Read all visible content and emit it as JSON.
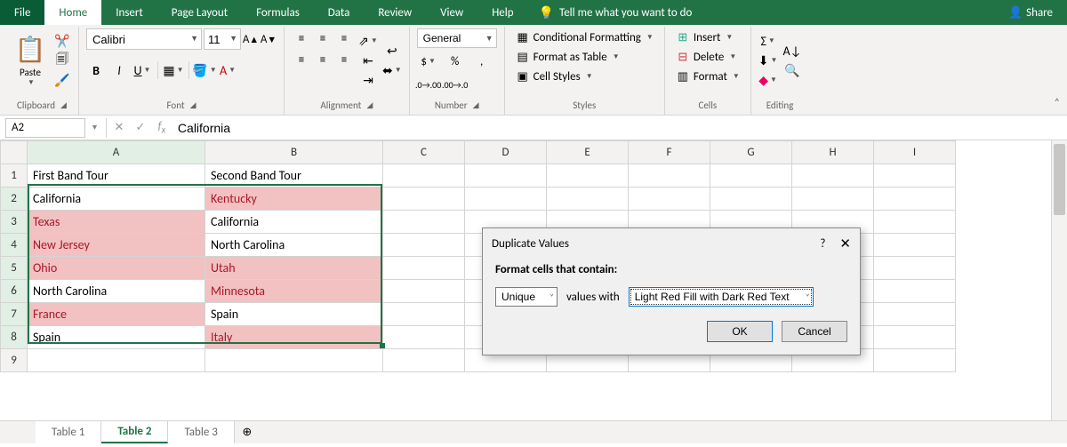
{
  "tabs": {
    "file": "File",
    "home": "Home",
    "insert": "Insert",
    "pagelayout": "Page Layout",
    "formulas": "Formulas",
    "data": "Data",
    "review": "Review",
    "view": "View",
    "help": "Help",
    "tellme": "Tell me what you want to do",
    "share": "Share"
  },
  "ribbon": {
    "clipboard": {
      "label": "Clipboard",
      "paste": "Paste"
    },
    "font": {
      "label": "Font",
      "name": "Calibri",
      "size": "11"
    },
    "alignment": {
      "label": "Alignment"
    },
    "number": {
      "label": "Number",
      "format": "General"
    },
    "styles": {
      "label": "Styles",
      "cond": "Conditional Formatting",
      "table": "Format as Table",
      "cell": "Cell Styles"
    },
    "cells": {
      "label": "Cells",
      "insert": "Insert",
      "delete": "Delete",
      "format": "Format"
    },
    "editing": {
      "label": "Editing"
    }
  },
  "namebox": "A2",
  "formula": "California",
  "columns": [
    "A",
    "B",
    "C",
    "D",
    "E",
    "F",
    "G",
    "H",
    "I"
  ],
  "headers": {
    "A": "First Band Tour",
    "B": "Second Band Tour"
  },
  "rows": [
    {
      "n": "2",
      "A": "California",
      "B": "Kentucky",
      "hlA": false,
      "hlB": true
    },
    {
      "n": "3",
      "A": "Texas",
      "B": "California",
      "hlA": true,
      "hlB": false
    },
    {
      "n": "4",
      "A": "New Jersey",
      "B": "North Carolina",
      "hlA": true,
      "hlB": false
    },
    {
      "n": "5",
      "A": "Ohio",
      "B": "Utah",
      "hlA": true,
      "hlB": true
    },
    {
      "n": "6",
      "A": "North Carolina",
      "B": "Minnesota",
      "hlA": false,
      "hlB": true
    },
    {
      "n": "7",
      "A": "France",
      "B": "Spain",
      "hlA": true,
      "hlB": false
    },
    {
      "n": "8",
      "A": "Spain",
      "B": "Italy",
      "hlA": false,
      "hlB": true
    }
  ],
  "extraRow": "9",
  "sheets": {
    "t1": "Table 1",
    "t2": "Table 2",
    "t3": "Table 3"
  },
  "dialog": {
    "title": "Duplicate Values",
    "help": "?",
    "close": "✕",
    "heading": "Format cells that contain:",
    "sel1": "Unique",
    "mid": "values with",
    "sel2": "Light Red Fill with Dark Red Text",
    "ok": "OK",
    "cancel": "Cancel"
  }
}
